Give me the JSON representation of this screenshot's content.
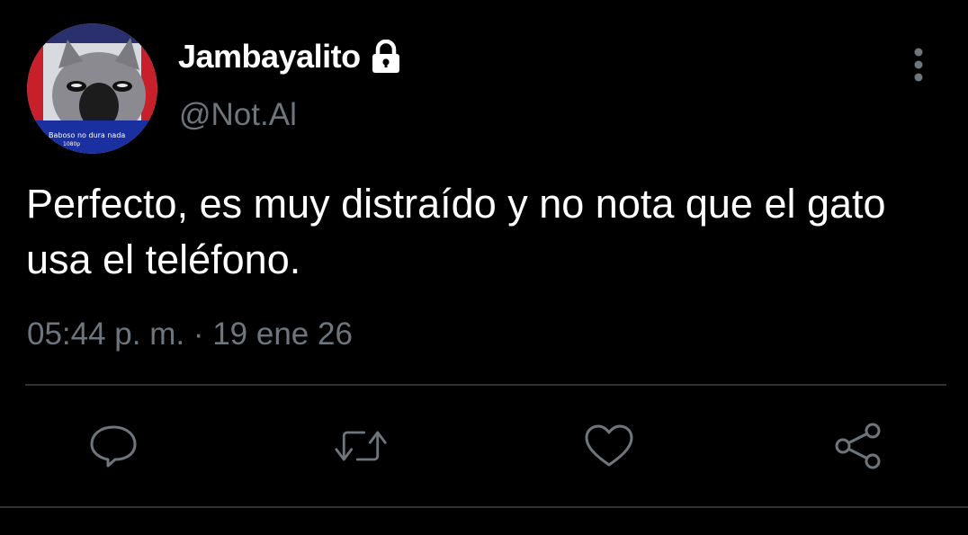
{
  "user": {
    "display_name": "Jambayalito",
    "handle": "@Not.Al",
    "avatar_caption": "Baboso no dura nada",
    "avatar_subcaption": "1080p"
  },
  "tweet": {
    "text": "Perfecto, es muy distraído y no nota que el gato usa el teléfono.",
    "time": "05:44 p. m.",
    "separator": " · ",
    "date": "19 ene 26"
  },
  "actions": [
    "reply-icon",
    "retweet-icon",
    "like-icon",
    "share-icon"
  ],
  "colors": {
    "background": "#000000",
    "text": "#ffffff",
    "secondary": "#6e767d",
    "divider": "#2f3336",
    "avatar_ring_red": "#c8202a",
    "avatar_ring_blue": "#1a2fa0"
  }
}
